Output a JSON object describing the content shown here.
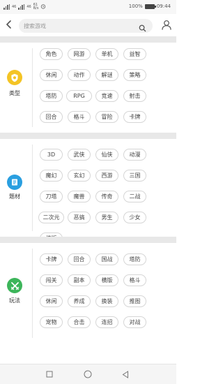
{
  "status_bar": {
    "signal_1": "46",
    "signal_2": "46",
    "net_speed_value": "61",
    "net_speed_unit": "B/s",
    "battery": "100%",
    "time": "09:44"
  },
  "header": {
    "search_placeholder": "搜索游戏",
    "search_value": ""
  },
  "sections": [
    {
      "label": "类型",
      "icon": "shield-icon",
      "icon_color": "#f4c425",
      "tags": [
        "角色",
        "网游",
        "单机",
        "益智",
        "休闲",
        "动作",
        "解谜",
        "策略",
        "塔防",
        "RPG",
        "竞速",
        "射击",
        "回合",
        "格斗",
        "冒险",
        "卡牌"
      ]
    },
    {
      "label": "题材",
      "icon": "book-icon",
      "icon_color": "#2a9fe0",
      "tags": [
        "3D",
        "武侠",
        "仙侠",
        "动漫",
        "魔幻",
        "玄幻",
        "西游",
        "三国",
        "刀塔",
        "魔兽",
        "传奇",
        "二战",
        "二次元",
        "恶搞",
        "男生",
        "少女",
        "横版"
      ]
    },
    {
      "label": "玩法",
      "icon": "crossed-swords-icon",
      "icon_color": "#3cb55a",
      "tags": [
        "卡牌",
        "回合",
        "国战",
        "塔防",
        "闯关",
        "副本",
        "横版",
        "格斗",
        "休闲",
        "养成",
        "换装",
        "推图",
        "宠物",
        "合击",
        "连招",
        "对战"
      ]
    }
  ],
  "colors": {
    "divider": "#e8e8e8",
    "tag_border": "#d6d6d6"
  }
}
